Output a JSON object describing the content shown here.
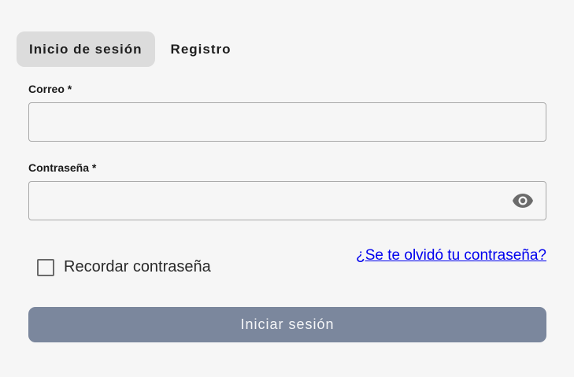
{
  "tabs": [
    {
      "label": "Inicio de sesión",
      "active": true
    },
    {
      "label": "Registro",
      "active": false
    }
  ],
  "form": {
    "email_label": "Correo *",
    "email_value": "",
    "password_label": "Contraseña *",
    "password_value": "",
    "password_toggle_icon": "eye-icon",
    "remember_label": "Recordar contraseña",
    "remember_checked": false,
    "forgot_link": "¿Se te olvidó tu contraseña?",
    "submit_label": "Iniciar sesión"
  },
  "colors": {
    "background": "#f6f6f6",
    "active_tab": "#dcdcdc",
    "submit_button": "#7b879d",
    "link": "#0000ee"
  }
}
